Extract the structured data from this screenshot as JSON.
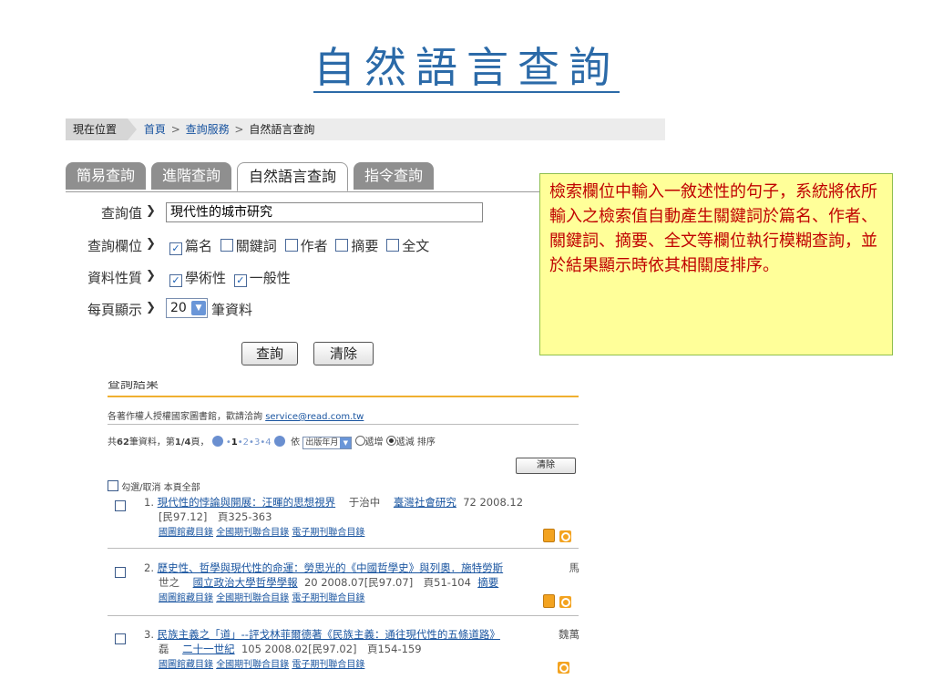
{
  "title": "自然語言查詢",
  "breadcrumb": {
    "here": "現在位置",
    "home": "首頁",
    "service": "查詢服務",
    "current": "自然語言查詢",
    "sep": ">"
  },
  "tabs": [
    {
      "label": "簡易查詢",
      "active": false
    },
    {
      "label": "進階查詢",
      "active": false
    },
    {
      "label": "自然語言查詢",
      "active": true
    },
    {
      "label": "指令查詢",
      "active": false
    }
  ],
  "form": {
    "query_label": "查詢值",
    "query_value": "現代性的城市研究",
    "field_label": "查詢欄位",
    "fields": [
      {
        "label": "篇名",
        "checked": true
      },
      {
        "label": "關鍵詞",
        "checked": false
      },
      {
        "label": "作者",
        "checked": false
      },
      {
        "label": "摘要",
        "checked": false
      },
      {
        "label": "全文",
        "checked": false
      }
    ],
    "type_label": "資料性質",
    "types": [
      {
        "label": "學術性",
        "checked": true
      },
      {
        "label": "一般性",
        "checked": true
      }
    ],
    "per_page_label": "每頁顯示",
    "per_page_value": "20",
    "per_page_unit": "筆資料",
    "submit_label": "查詢",
    "clear_label": "清除"
  },
  "note": "檢索欄位中輸入一敘述性的句子，系統將依所輸入之檢索值自動產生關鍵詞於篇名、作者、關鍵詞、摘要、全文等欄位執行模糊查詢，並於結果顯示時依其相關度排序。",
  "results": {
    "heading": "查詢結果",
    "copyright_text": "各著作權人授權國家圖書館，歡請洽詢",
    "copyright_email": "service@read.com.tw",
    "summary_pre": "共",
    "total": "62",
    "summary_mid": "筆資料，第",
    "page": "1/4",
    "summary_post": "頁，",
    "pages": [
      "1",
      "2",
      "3",
      "4"
    ],
    "sort_by": "依",
    "sort_field": "出版年月",
    "sort_asc": "遞增",
    "sort_desc": "遞減",
    "sort_word": "排序",
    "clear_label": "清除",
    "select_all": "勾選/取消 本頁全部",
    "items": [
      {
        "num": "1.",
        "title": "現代性的悖論與開展：汪暉的思想視界",
        "author": "于治中",
        "journal": "臺灣社會研究",
        "line1_rest": "72 2008.12",
        "line2": "[民97.12]　頁325-363",
        "links": [
          "國圖館藏目錄",
          "全國期刊聯合目錄",
          "電子期刊聯合目錄"
        ]
      },
      {
        "num": "2.",
        "title": "歷史性、哲學與現代性的命運：勞思光的《中國哲學史》與列奧．施特勞斯",
        "author_tail": "馬",
        "author_head": "世之",
        "journal": "國立政治大學哲學學報",
        "line2_rest": "20 2008.07[民97.07]　頁51-104",
        "abstract": "摘要",
        "links": [
          "國圖館藏目錄",
          "全國期刊聯合目錄",
          "電子期刊聯合目錄"
        ]
      },
      {
        "num": "3.",
        "title": "民族主義之「道」--評戈林菲爾德著《民族主義：通往現代性的五條道路》",
        "author_tail": "魏萬",
        "author_head": "磊",
        "journal": "二十一世紀",
        "line2_rest": "105 2008.02[民97.02]　頁154-159",
        "links": [
          "國圖館藏目錄",
          "全國期刊聯合目錄",
          "電子期刊聯合目錄"
        ]
      }
    ]
  }
}
